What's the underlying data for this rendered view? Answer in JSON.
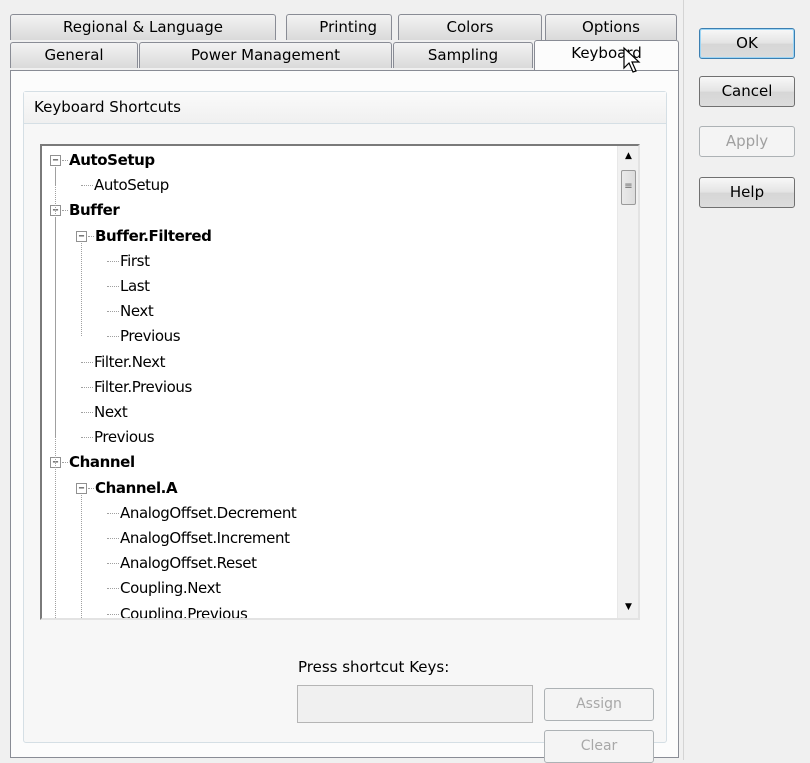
{
  "tabs": {
    "row1": [
      {
        "label": "Regional & Language"
      },
      {
        "label": "Printing"
      },
      {
        "label": "Colors"
      },
      {
        "label": "Options"
      }
    ],
    "row2": [
      {
        "label": "General"
      },
      {
        "label": "Power Management"
      },
      {
        "label": "Sampling"
      },
      {
        "label": "Keyboard"
      }
    ]
  },
  "group_title": "Keyboard Shortcuts",
  "tree": {
    "items": [
      {
        "label": "AutoSetup",
        "bold": true,
        "level": 0,
        "expanded": true
      },
      {
        "label": "AutoSetup",
        "bold": false,
        "level": 1
      },
      {
        "label": "Buffer",
        "bold": true,
        "level": 0,
        "expanded": true
      },
      {
        "label": "Buffer.Filtered",
        "bold": true,
        "level": 1,
        "expanded": true
      },
      {
        "label": "First",
        "bold": false,
        "level": 2
      },
      {
        "label": "Last",
        "bold": false,
        "level": 2
      },
      {
        "label": "Next",
        "bold": false,
        "level": 2
      },
      {
        "label": "Previous",
        "bold": false,
        "level": 2
      },
      {
        "label": "Filter.Next",
        "bold": false,
        "level": 1
      },
      {
        "label": "Filter.Previous",
        "bold": false,
        "level": 1
      },
      {
        "label": "Next",
        "bold": false,
        "level": 1
      },
      {
        "label": "Previous",
        "bold": false,
        "level": 1
      },
      {
        "label": "Channel",
        "bold": true,
        "level": 0,
        "expanded": true
      },
      {
        "label": "Channel.A",
        "bold": true,
        "level": 1,
        "expanded": true
      },
      {
        "label": "AnalogOffset.Decrement",
        "bold": false,
        "level": 2
      },
      {
        "label": "AnalogOffset.Increment",
        "bold": false,
        "level": 2
      },
      {
        "label": "AnalogOffset.Reset",
        "bold": false,
        "level": 2
      },
      {
        "label": "Coupling.Next",
        "bold": false,
        "level": 2
      },
      {
        "label": "Coupling.Previous",
        "bold": false,
        "level": 2
      }
    ]
  },
  "shortcut": {
    "label": "Press shortcut Keys:",
    "value": "",
    "assign_label": "Assign",
    "clear_label": "Clear"
  },
  "dialog_buttons": {
    "ok": "OK",
    "cancel": "Cancel",
    "apply": "Apply",
    "help": "Help"
  },
  "icons": {
    "expander": "minus-box-icon",
    "scroll_up": "arrow-up-icon",
    "scroll_down": "arrow-down-icon",
    "cursor": "mouse-pointer-icon"
  }
}
